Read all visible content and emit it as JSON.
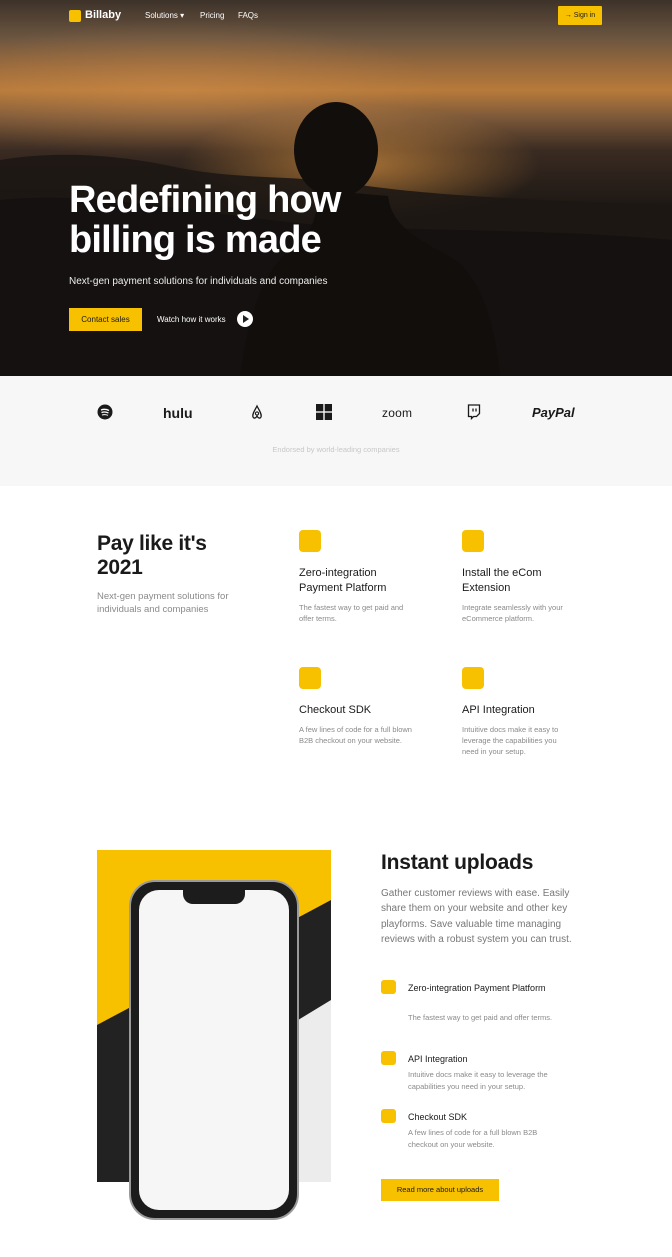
{
  "nav": {
    "brand": "Billaby",
    "items": [
      "Solutions ▾",
      "Pricing",
      "FAQs"
    ],
    "signin": "→ Sign in"
  },
  "hero": {
    "title_line1": "Redefining how",
    "title_line2": "billing is made",
    "subtitle": "Next-gen payment solutions for individuals and companies",
    "contact_label": "Contact sales",
    "watch_label": "Watch how it works"
  },
  "logos": {
    "brands": [
      "hulu",
      "zoom",
      "PayPal"
    ],
    "icons": [
      "spotify-icon",
      "airbnb-icon",
      "windows-icon",
      "twitch-icon"
    ],
    "endorsed": "Endorsed by world-leading companies"
  },
  "features": {
    "title_line1": "Pay like it's",
    "title_line2": "2021",
    "subtitle": "Next-gen payment solutions for individuals and companies",
    "items": [
      {
        "title": "Zero-integration Payment Platform",
        "desc": "The fastest way to get paid and offer terms."
      },
      {
        "title": "Install the eCom Extension",
        "desc": "Integrate seamlessly with your eCommerce platform."
      },
      {
        "title": "Checkout SDK",
        "desc": "A few lines of code for a full blown B2B checkout on your website."
      },
      {
        "title": "API Integration",
        "desc": "Intuitive docs make it easy to leverage the capabilities you need in your setup."
      }
    ]
  },
  "uploads": {
    "title": "Instant uploads",
    "text": "Gather customer reviews with ease. Easily share them on your website and other key playforms. Save valuable time managing reviews with a robust system you can trust.",
    "items": [
      {
        "title": "Zero-integration Payment Platform",
        "desc": "The fastest way to get paid and offer terms."
      },
      {
        "title": "API Integration",
        "desc": "Intuitive docs make it easy to leverage the capabilities you need in your setup."
      },
      {
        "title": "Checkout SDK",
        "desc": "A few lines of code for a full blown B2B checkout on your website."
      }
    ],
    "button": "Read more about uploads"
  },
  "colors": {
    "accent": "#f7c100",
    "dark": "#1a1a1a"
  }
}
